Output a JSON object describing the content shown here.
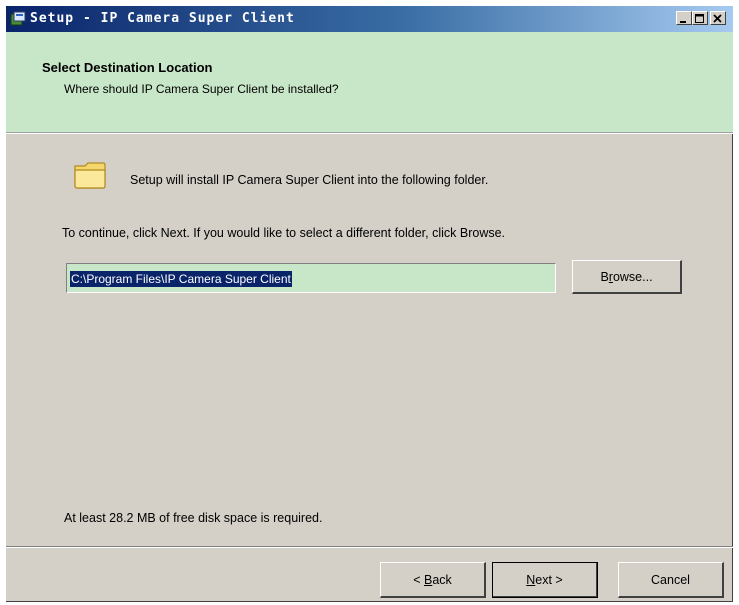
{
  "window": {
    "title": "Setup - IP Camera Super Client"
  },
  "header": {
    "title": "Select Destination Location",
    "subtitle": "Where should IP Camera Super Client be installed?"
  },
  "main": {
    "install_text": "Setup will install IP Camera Super Client into the following folder.",
    "continue_text": "To continue, click Next. If you would like to select a different folder, click Browse.",
    "path_value": "C:\\Program Files\\IP Camera Super Client",
    "browse": {
      "pre": "B",
      "accel": "r",
      "post": "owse..."
    },
    "space_text": "At least 28.2 MB of free disk space is required."
  },
  "footer": {
    "back": {
      "pre": "< ",
      "accel": "B",
      "post": "ack"
    },
    "next": {
      "pre": "",
      "accel": "N",
      "post": "ext >"
    },
    "cancel": "Cancel"
  },
  "colors": {
    "header_bg": "#c8e6c8",
    "dialog_bg": "#d4d0c8",
    "selection": "#0a246a"
  },
  "icons": {
    "app": "setup-app-icon",
    "folder": "folder-icon",
    "minimize": "minimize-icon",
    "maximize": "maximize-icon",
    "close": "close-icon"
  }
}
